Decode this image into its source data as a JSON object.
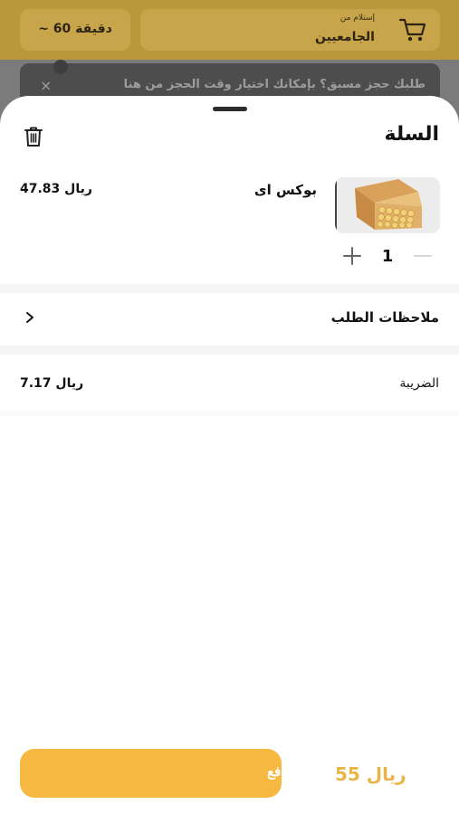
{
  "header": {
    "time_estimate": "~ 60 دقيقة",
    "pickup_small": "إستلام من",
    "pickup_location": "الجامعيين"
  },
  "toast": {
    "message": "طلبك حجز مسبق؟ بإمكانك اختيار وقت الحجز من هنا",
    "close_glyph": "×"
  },
  "cart": {
    "title": "السلة",
    "item": {
      "name": "بوكس اى",
      "price": "47.83 ريال",
      "quantity": "1"
    },
    "notes_label": "ملاحظات الطلب",
    "tax_label": "الضريبة",
    "tax_value": "7.17 ريال"
  },
  "footer": {
    "pay_label": "الدفع",
    "total": "55 ريال"
  },
  "colors": {
    "accent": "#f5b841",
    "total_text": "#e8b548"
  },
  "icons": [
    "cart-icon",
    "close-icon",
    "trash-icon",
    "minus-icon",
    "plus-icon",
    "chevron-right-icon"
  ]
}
